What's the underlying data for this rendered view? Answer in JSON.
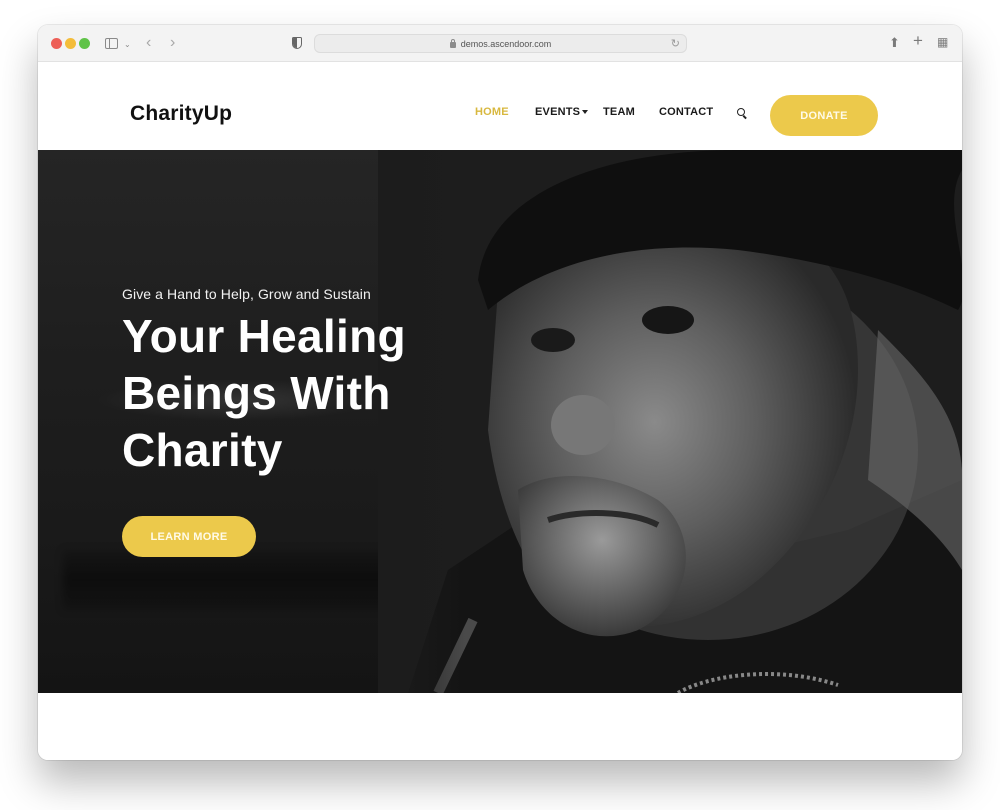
{
  "browser": {
    "url": "demos.ascendoor.com",
    "icons": [
      "close-dot",
      "minimize-dot",
      "zoom-dot",
      "sidebar-icon",
      "chevron-down-icon",
      "back-icon",
      "forward-icon",
      "shield-icon",
      "lock-icon",
      "reload-icon",
      "share-icon",
      "plus-icon",
      "tabs-grid-icon"
    ]
  },
  "header": {
    "logo": "CharityUp",
    "nav": [
      {
        "label": "HOME",
        "active": true
      },
      {
        "label": "EVENTS",
        "has_dropdown": true
      },
      {
        "label": "TEAM"
      },
      {
        "label": "CONTACT"
      }
    ],
    "search_icon": "search-icon",
    "donate_label": "DONATE"
  },
  "hero": {
    "subtitle": "Give a Hand to Help, Grow and Sustain",
    "title_lines": [
      "Your Healing",
      "Beings With",
      "Charity"
    ],
    "cta_label": "LEARN MORE",
    "image": "black-and-white portrait of an elderly man in a knit beanie"
  },
  "colors": {
    "accent": "#ecc94b",
    "nav_active": "#d8b83f",
    "text_dark": "#111111",
    "hero_bg": "#1c1c1c"
  }
}
